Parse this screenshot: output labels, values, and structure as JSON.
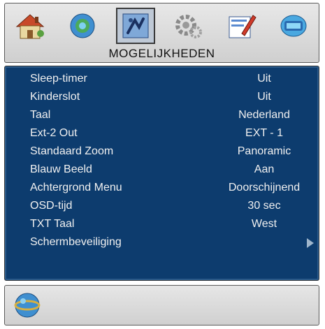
{
  "header": {
    "title": "MOGELIJKHEDEN",
    "icons": [
      {
        "name": "home-icon"
      },
      {
        "name": "picture-icon"
      },
      {
        "name": "options-icon",
        "selected": true
      },
      {
        "name": "settings-gear-icon"
      },
      {
        "name": "edit-icon"
      },
      {
        "name": "source-icon"
      }
    ]
  },
  "menu": {
    "items": [
      {
        "label": "Sleep-timer",
        "value": "Uit"
      },
      {
        "label": "Kinderslot",
        "value": "Uit"
      },
      {
        "label": "Taal",
        "value": "Nederland"
      },
      {
        "label": "Ext-2 Out",
        "value": "EXT - 1"
      },
      {
        "label": "Standaard Zoom",
        "value": "Panoramic"
      },
      {
        "label": "Blauw Beeld",
        "value": "Aan"
      },
      {
        "label": "Achtergrond Menu",
        "value": "Doorschijnend"
      },
      {
        "label": "OSD-tijd",
        "value": "30 sec"
      },
      {
        "label": "TXT Taal",
        "value": "West"
      },
      {
        "label": "Schermbeveiliging",
        "value": ""
      }
    ]
  },
  "footer": {
    "icon": "globe-icon"
  },
  "colors": {
    "panel": "#0d3c6e",
    "bar": "#d8d8d8",
    "text": "#f0f0f0"
  }
}
